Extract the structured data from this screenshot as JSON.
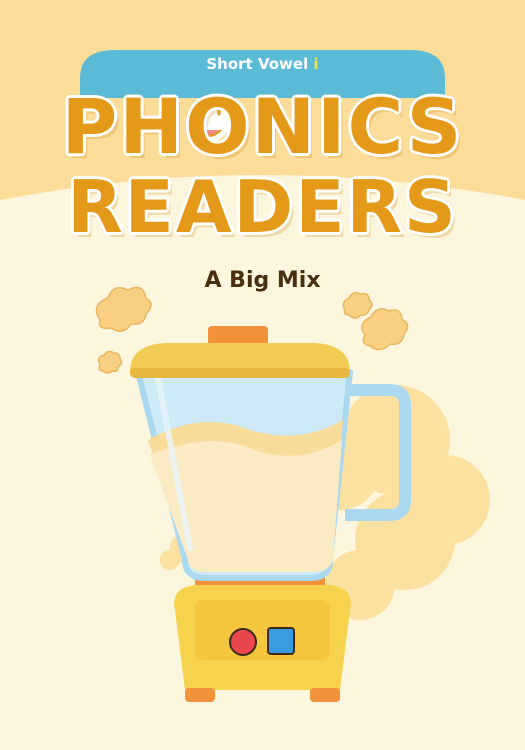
{
  "cover": {
    "series_label": "Short Vowel",
    "vowel_letter": "i",
    "series_title_line1": "PHONICS",
    "series_title_line2": "READERS",
    "book_title": "A Big Mix"
  },
  "colors": {
    "background": "#FDF6DE",
    "header_band": "#FBDC99",
    "banner": "#5BBBD6",
    "title_orange": "#E49A18",
    "book_title_brown": "#4A2E12",
    "blender_lid": "#F2CC52",
    "blender_jar": "#A9D8EF",
    "blender_base": "#F6D24D",
    "dust_cloud": "#FBE1A0",
    "red_button": "#E8474D",
    "blue_button": "#3B9BE0"
  },
  "icons": [
    "face-icon",
    "blender-illustration",
    "dust-puff-icon",
    "red-button-icon",
    "blue-button-icon"
  ]
}
